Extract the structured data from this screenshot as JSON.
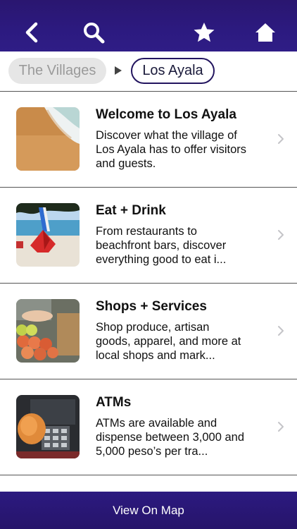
{
  "header": {
    "back_icon": "chevron-left-icon",
    "search_icon": "search-icon",
    "favorite_icon": "star-icon",
    "home_icon": "home-icon"
  },
  "breadcrumb": {
    "parent": "The Villages",
    "current": "Los Ayala"
  },
  "items": [
    {
      "title": "Welcome to Los Ayala",
      "description": "Discover what the village of Los Ayala has to offer visitors and guests."
    },
    {
      "title": "Eat + Drink",
      "description": "From restaurants to beachfront bars, discover everything good to eat i..."
    },
    {
      "title": "Shops + Services",
      "description": "Shop produce, artisan goods, apparel, and more at local shops and mark..."
    },
    {
      "title": "ATMs",
      "description": "ATMs are available and dispense between 3,000 and 5,000 peso’s per tra..."
    }
  ],
  "footer": {
    "map_label": "View On Map"
  },
  "colors": {
    "header_bg": "#2c1a80",
    "breadcrumb_border": "#23155f"
  }
}
